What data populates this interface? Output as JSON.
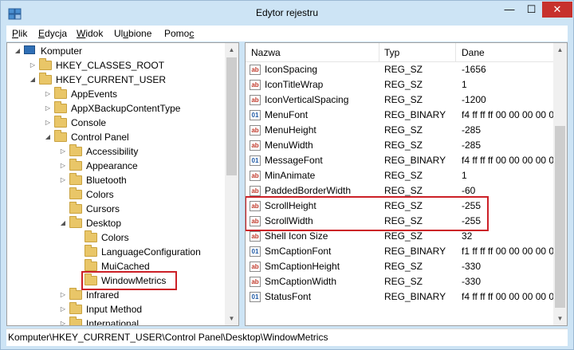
{
  "window": {
    "title": "Edytor rejestru"
  },
  "menu": [
    {
      "ul": "P",
      "rest": "lik"
    },
    {
      "ul": "E",
      "rest": "dycja"
    },
    {
      "ul": "W",
      "rest": "idok"
    },
    {
      "pre": "Ul",
      "ul": "u",
      "rest": "bione"
    },
    {
      "pre": "Pomo",
      "ul": "c",
      "rest": ""
    }
  ],
  "tree": [
    {
      "label": "Komputer",
      "depth": 0,
      "arrow": "open",
      "icon": "computer"
    },
    {
      "label": "HKEY_CLASSES_ROOT",
      "depth": 1,
      "arrow": "closed",
      "icon": "folder"
    },
    {
      "label": "HKEY_CURRENT_USER",
      "depth": 1,
      "arrow": "open",
      "icon": "folder"
    },
    {
      "label": "AppEvents",
      "depth": 2,
      "arrow": "closed",
      "icon": "folder"
    },
    {
      "label": "AppXBackupContentType",
      "depth": 2,
      "arrow": "closed",
      "icon": "folder"
    },
    {
      "label": "Console",
      "depth": 2,
      "arrow": "closed",
      "icon": "folder"
    },
    {
      "label": "Control Panel",
      "depth": 2,
      "arrow": "open",
      "icon": "folder"
    },
    {
      "label": "Accessibility",
      "depth": 3,
      "arrow": "closed",
      "icon": "folder"
    },
    {
      "label": "Appearance",
      "depth": 3,
      "arrow": "closed",
      "icon": "folder"
    },
    {
      "label": "Bluetooth",
      "depth": 3,
      "arrow": "closed",
      "icon": "folder"
    },
    {
      "label": "Colors",
      "depth": 3,
      "arrow": "none",
      "icon": "folder"
    },
    {
      "label": "Cursors",
      "depth": 3,
      "arrow": "none",
      "icon": "folder"
    },
    {
      "label": "Desktop",
      "depth": 3,
      "arrow": "open",
      "icon": "folder"
    },
    {
      "label": "Colors",
      "depth": 4,
      "arrow": "none",
      "icon": "folder"
    },
    {
      "label": "LanguageConfiguration",
      "depth": 4,
      "arrow": "none",
      "icon": "folder"
    },
    {
      "label": "MuiCached",
      "depth": 4,
      "arrow": "none",
      "icon": "folder"
    },
    {
      "label": "WindowMetrics",
      "depth": 4,
      "arrow": "none",
      "icon": "folder",
      "highlight": true
    },
    {
      "label": "Infrared",
      "depth": 3,
      "arrow": "closed",
      "icon": "folder"
    },
    {
      "label": "Input Method",
      "depth": 3,
      "arrow": "closed",
      "icon": "folder"
    },
    {
      "label": "International",
      "depth": 3,
      "arrow": "closed",
      "icon": "folder"
    }
  ],
  "columns": {
    "name": "Nazwa",
    "type": "Typ",
    "data": "Dane"
  },
  "values": [
    {
      "name": "IconSpacing",
      "type": "REG_SZ",
      "data": "-1656"
    },
    {
      "name": "IconTitleWrap",
      "type": "REG_SZ",
      "data": "1"
    },
    {
      "name": "IconVerticalSpacing",
      "type": "REG_SZ",
      "data": "-1200"
    },
    {
      "name": "MenuFont",
      "type": "REG_BINARY",
      "data": "f4 ff ff ff 00 00 00 00 00"
    },
    {
      "name": "MenuHeight",
      "type": "REG_SZ",
      "data": "-285"
    },
    {
      "name": "MenuWidth",
      "type": "REG_SZ",
      "data": "-285"
    },
    {
      "name": "MessageFont",
      "type": "REG_BINARY",
      "data": "f4 ff ff ff 00 00 00 00 00"
    },
    {
      "name": "MinAnimate",
      "type": "REG_SZ",
      "data": "1"
    },
    {
      "name": "PaddedBorderWidth",
      "type": "REG_SZ",
      "data": "-60"
    },
    {
      "name": "ScrollHeight",
      "type": "REG_SZ",
      "data": "-255"
    },
    {
      "name": "ScrollWidth",
      "type": "REG_SZ",
      "data": "-255"
    },
    {
      "name": "Shell Icon Size",
      "type": "REG_SZ",
      "data": "32"
    },
    {
      "name": "SmCaptionFont",
      "type": "REG_BINARY",
      "data": "f1 ff ff ff 00 00 00 00 00"
    },
    {
      "name": "SmCaptionHeight",
      "type": "REG_SZ",
      "data": "-330"
    },
    {
      "name": "SmCaptionWidth",
      "type": "REG_SZ",
      "data": "-330"
    },
    {
      "name": "StatusFont",
      "type": "REG_BINARY",
      "data": "f4 ff ff ff 00 00 00 00 00"
    }
  ],
  "status": {
    "path": "Komputer\\HKEY_CURRENT_USER\\Control Panel\\Desktop\\WindowMetrics"
  },
  "colors": {
    "highlight": "#cc2027",
    "folder": "#e9c668",
    "close": "#c7312c"
  }
}
